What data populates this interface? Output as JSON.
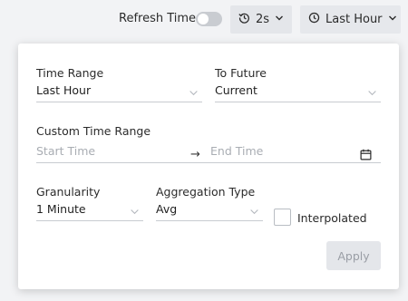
{
  "toolbar": {
    "refresh_label": "Refresh Time",
    "refresh_enabled": false,
    "interval_value": "2s",
    "time_range_value": "Last Hour"
  },
  "panel": {
    "time_range": {
      "label": "Time Range",
      "value": "Last Hour"
    },
    "to_future": {
      "label": "To Future",
      "value": "Current"
    },
    "custom_time_range": {
      "label": "Custom Time Range",
      "start_placeholder": "Start Time",
      "end_placeholder": "End Time",
      "separator": "→"
    },
    "granularity": {
      "label": "Granularity",
      "value": "1 Minute"
    },
    "aggregation_type": {
      "label": "Aggregation Type",
      "value": "Avg"
    },
    "interpolated": {
      "label": "Interpolated",
      "checked": false
    },
    "apply_label": "Apply"
  },
  "icons": {
    "history": "history-icon",
    "clock": "clock-icon",
    "chevron": "chevron-down-icon",
    "calendar": "calendar-icon"
  },
  "colors": {
    "panel_bg": "#ffffff",
    "button_bg": "#e4e6ea",
    "toggle_off": "#c9ccd1",
    "underline": "#c8cbd0",
    "placeholder": "#a9adb3"
  }
}
